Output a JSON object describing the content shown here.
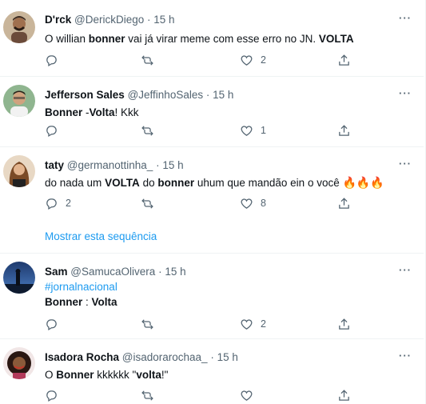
{
  "tweets": [
    {
      "name": "D'rck",
      "handle": "@DerickDiego",
      "sep": "·",
      "time": "15 h",
      "text_parts": [
        "O willian ",
        "bonner",
        " vai já virar meme com esse erro no JN. ",
        "VOLTA"
      ],
      "reply_count": "",
      "retweet_count": "",
      "like_count": "2"
    },
    {
      "name": "Jefferson Sales",
      "handle": "@JeffinhoSales",
      "sep": "·",
      "time": "15 h",
      "text_parts": [
        "Bonner",
        " -",
        "Volta",
        "! Kkk"
      ],
      "reply_count": "",
      "retweet_count": "",
      "like_count": "1"
    },
    {
      "name": "taty",
      "handle": "@germanottinha_",
      "sep": "·",
      "time": "15 h",
      "text_parts": [
        "do nada um ",
        "VOLTA",
        " do ",
        "bonner",
        " uhum que mandão ein o você "
      ],
      "emoji": "🔥🔥🔥",
      "reply_count": "2",
      "retweet_count": "",
      "like_count": "8"
    },
    {
      "name": "Sam",
      "handle": "@SamucaOlivera",
      "sep": "·",
      "time": "15 h",
      "hashtag": "#jornalnacional",
      "text_parts": [
        "Bonner",
        " : ",
        "Volta"
      ],
      "reply_count": "",
      "retweet_count": "",
      "like_count": "2"
    },
    {
      "name": "Isadora Rocha",
      "handle": "@isadorarochaa_",
      "sep": "·",
      "time": "15 h",
      "text_parts": [
        "O ",
        "Bonner",
        " kkkkkk \"",
        "volta",
        "!\""
      ],
      "reply_count": "",
      "retweet_count": "",
      "like_count": ""
    }
  ],
  "thread_link": "Mostrar esta sequência",
  "icons": {
    "more": "more-dots-icon",
    "reply": "reply-icon",
    "retweet": "retweet-icon",
    "like": "heart-icon",
    "share": "share-icon"
  },
  "colors": {
    "link": "#1d9bf0",
    "muted": "#536471",
    "text": "#0f1419",
    "border": "#eff3f4"
  }
}
